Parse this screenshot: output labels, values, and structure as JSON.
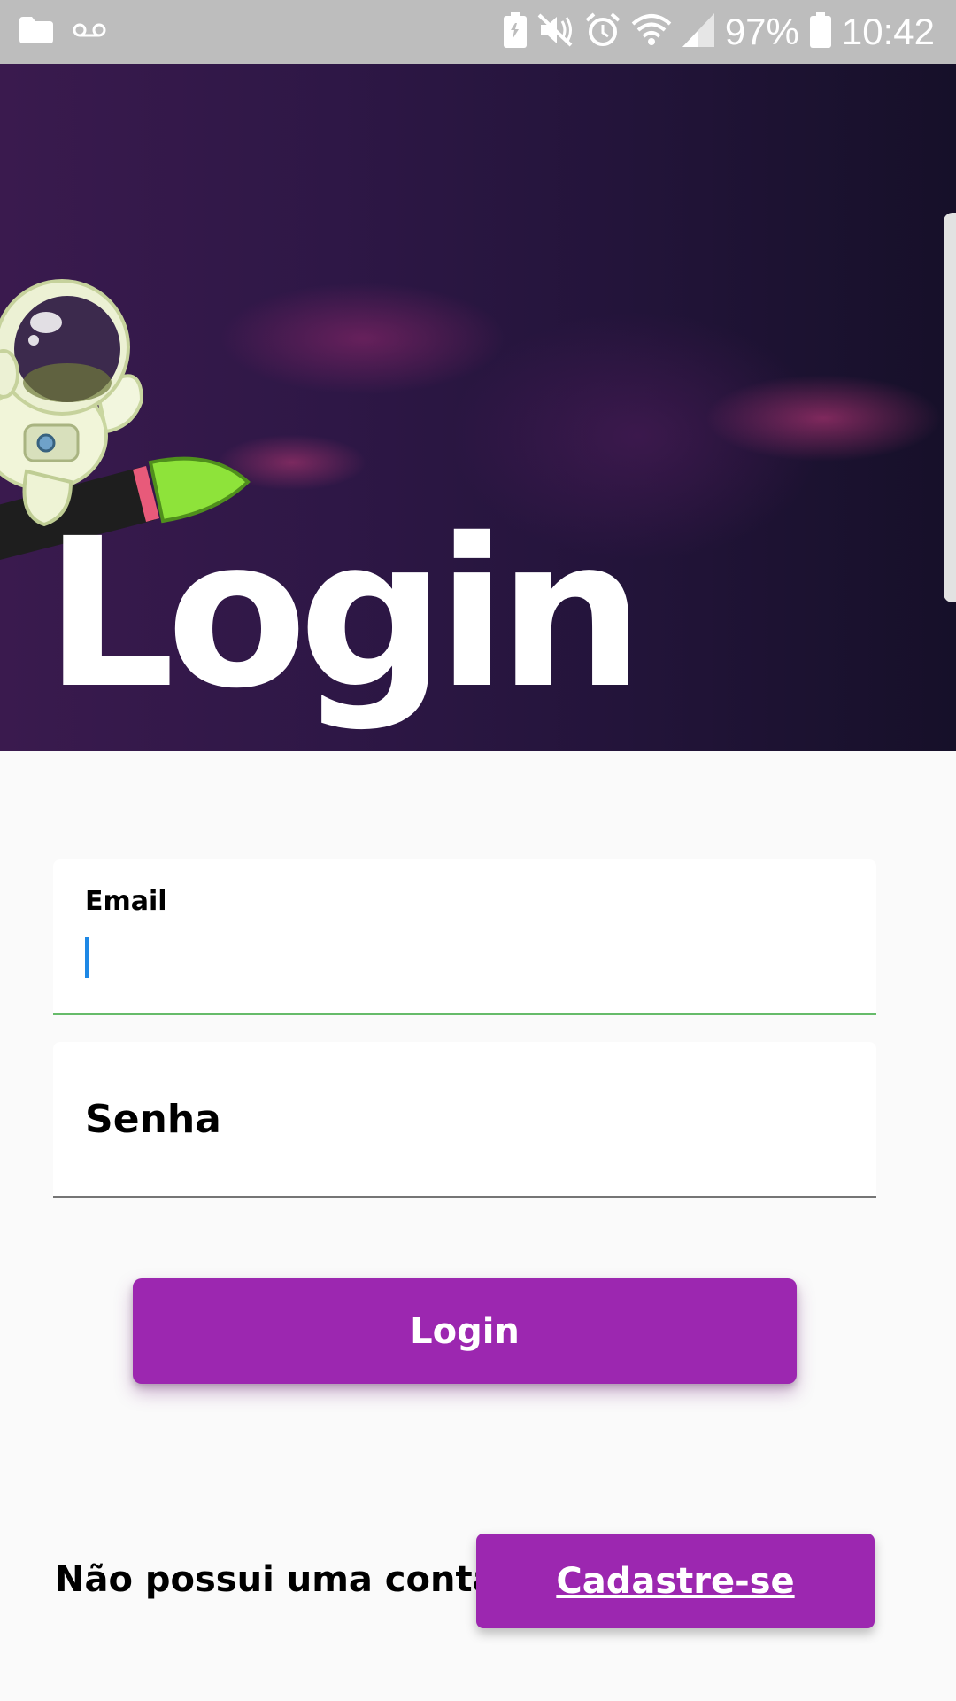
{
  "status_bar": {
    "battery_percent": "97%",
    "time": "10:42",
    "icons": [
      "folder-icon",
      "voicemail-icon",
      "battery-saver-icon",
      "mute-icon",
      "alarm-icon",
      "wifi-icon",
      "signal-icon",
      "battery-icon"
    ]
  },
  "hero": {
    "title": "Login",
    "illustration": "astronaut-on-rocket"
  },
  "form": {
    "email_label": "Email",
    "email_value": "",
    "password_label": "Senha",
    "password_value": ""
  },
  "actions": {
    "login_label": "Login",
    "signup_prompt": "Não possui uma conta?",
    "signup_label": "Cadastre-se"
  },
  "colors": {
    "accent": "#9c27b0",
    "email_underline": "#66bb6a",
    "cursor": "#1e88e5",
    "status_bar": "#bdbdbd"
  }
}
